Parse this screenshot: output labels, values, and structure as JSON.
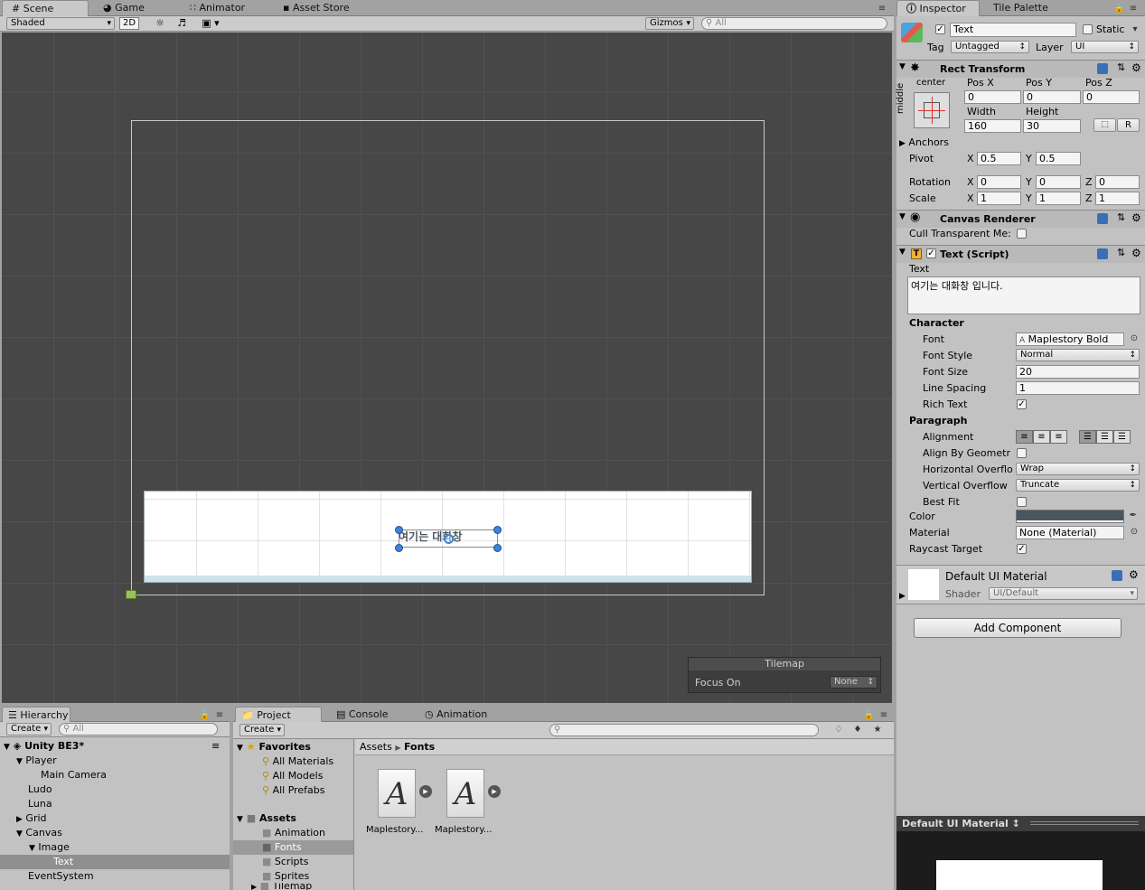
{
  "scene_tabs": {
    "scene": "Scene",
    "game": "Game",
    "animator": "Animator",
    "asset_store": "Asset Store"
  },
  "scene_toolbar": {
    "shading": "Shaded",
    "mode2d": "2D",
    "gizmos": "Gizmos",
    "search_placeholder": "All"
  },
  "scene_view": {
    "dialog_text": "여기는 대화창",
    "tilemap": {
      "title": "Tilemap",
      "focus_label": "Focus On",
      "focus_value": "None"
    }
  },
  "inspector": {
    "tabs": {
      "inspector": "Inspector",
      "tile_palette": "Tile Palette"
    },
    "object": {
      "name": "Text",
      "static_label": "Static",
      "tag_label": "Tag",
      "tag_value": "Untagged",
      "layer_label": "Layer",
      "layer_value": "UI"
    },
    "rect_transform": {
      "title": "Rect Transform",
      "anchor_h": "center",
      "anchor_v": "middle",
      "pos_x_label": "Pos X",
      "pos_y_label": "Pos Y",
      "pos_z_label": "Pos Z",
      "pos_x": "0",
      "pos_y": "0",
      "pos_z": "0",
      "width_label": "Width",
      "height_label": "Height",
      "width": "160",
      "height": "30",
      "r_btn": "R",
      "anchors": "Anchors",
      "pivot": "Pivot",
      "pivot_x": "0.5",
      "pivot_y": "0.5",
      "rotation": "Rotation",
      "rot_x": "0",
      "rot_y": "0",
      "rot_z": "0",
      "scale": "Scale",
      "scale_x": "1",
      "scale_y": "1",
      "scale_z": "1",
      "x": "X",
      "y": "Y",
      "z": "Z"
    },
    "canvas_renderer": {
      "title": "Canvas Renderer",
      "cull_label": "Cull Transparent Me:"
    },
    "text_script": {
      "title": "Text (Script)",
      "text_label": "Text",
      "text_value": "여기는 대화창 입니다.",
      "character": "Character",
      "font_label": "Font",
      "font_value": "Maplestory Bold",
      "font_style_label": "Font Style",
      "font_style_value": "Normal",
      "font_size_label": "Font Size",
      "font_size_value": "20",
      "line_spacing_label": "Line Spacing",
      "line_spacing_value": "1",
      "rich_text_label": "Rich Text",
      "paragraph": "Paragraph",
      "alignment_label": "Alignment",
      "align_geometry_label": "Align By Geometr",
      "h_overflow_label": "Horizontal Overflo",
      "h_overflow_value": "Wrap",
      "v_overflow_label": "Vertical Overflow",
      "v_overflow_value": "Truncate",
      "best_fit_label": "Best Fit",
      "color_label": "Color",
      "color_value": "#4a555e",
      "material_label": "Material",
      "material_value": "None (Material)",
      "raycast_label": "Raycast Target"
    },
    "material": {
      "name": "Default UI Material",
      "shader_label": "Shader",
      "shader_value": "UI/Default"
    },
    "add_component": "Add Component",
    "preview_title": "Default UI Material"
  },
  "hierarchy": {
    "tab": "Hierarchy",
    "create": "Create",
    "search_placeholder": "All",
    "scene_name": "Unity BE3*",
    "items": [
      "Player",
      "Main Camera",
      "Ludo",
      "Luna",
      "Grid",
      "Canvas",
      "Image",
      "Text",
      "EventSystem"
    ]
  },
  "project": {
    "tabs": {
      "project": "Project",
      "console": "Console",
      "animation": "Animation"
    },
    "create": "Create",
    "favorites": "Favorites",
    "fav_items": [
      "All Materials",
      "All Models",
      "All Prefabs"
    ],
    "assets": "Assets",
    "folders": [
      "Animation",
      "Fonts",
      "Scripts",
      "Sprites",
      "Tilemap"
    ],
    "breadcrumb": {
      "root": "Assets",
      "current": "Fonts"
    },
    "files": [
      "Maplestory...",
      "Maplestory..."
    ]
  }
}
